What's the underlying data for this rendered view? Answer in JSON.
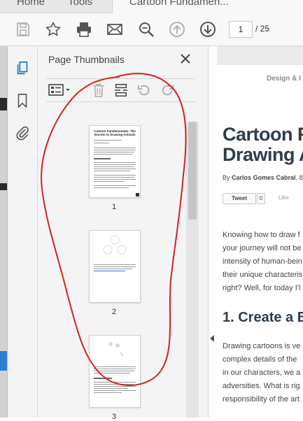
{
  "tabs": [
    {
      "label": "Home"
    },
    {
      "label": "Tools"
    },
    {
      "label": "Cartoon Fundamen..."
    }
  ],
  "toolbar": {
    "icons": [
      "save-icon",
      "bookmark-star-icon",
      "print-icon",
      "email-icon",
      "zoom-icon",
      "page-up-icon",
      "page-down-icon"
    ],
    "current_page": "1",
    "total_pages": "/ 25"
  },
  "nav_rail": [
    "page-thumbnails-icon",
    "bookmarks-icon",
    "attachments-icon"
  ],
  "thumbnails_panel": {
    "title": "Page Thumbnails",
    "tools": [
      "thumbnail-options-icon",
      "delete-page-icon",
      "insert-page-icon",
      "rotate-counterclockwise-icon",
      "rotate-clockwise-icon"
    ],
    "pages": [
      {
        "number": "1",
        "heading": "Cartoon Fundamentals: The Secrets to Drawing Animals"
      },
      {
        "number": "2"
      },
      {
        "number": "3"
      }
    ]
  },
  "document": {
    "category": "Design & I",
    "title_line1": "Cartoon F",
    "title_line2": "Drawing A",
    "byline_prefix": "By ",
    "byline_author": "Carlos Gomes Cabral",
    "byline_suffix": ", 8",
    "tweet_label": "Tweet",
    "tweet_count": "0",
    "like_label": "Like",
    "paragraph1": [
      "Knowing how to draw f",
      "your journey will not be",
      "intensity of human-bein",
      "their unique characteris",
      "right? Well, for today I'l"
    ],
    "section_heading": "1. Create a B",
    "paragraph2": [
      "Drawing cartoons is ve",
      "complex details of the",
      "in our characters, we a",
      "adversities. What is rig",
      "responsibility of the art"
    ]
  },
  "colors": {
    "annotation": "#d62020",
    "title_text": "#2e3d4c",
    "active_icon": "#1a73c8"
  }
}
